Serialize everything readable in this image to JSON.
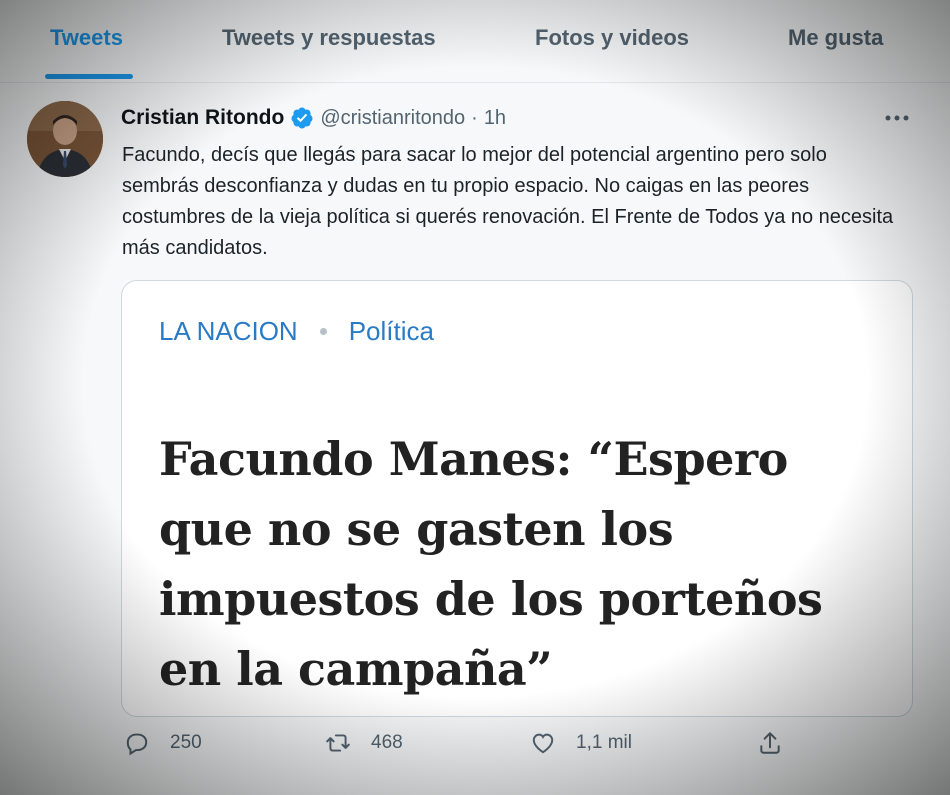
{
  "tabs": [
    {
      "label": "Tweets",
      "active": true
    },
    {
      "label": "Tweets y respuestas",
      "active": false
    },
    {
      "label": "Fotos y videos",
      "active": false
    },
    {
      "label": "Me gusta",
      "active": false
    }
  ],
  "tweet": {
    "author_name": "Cristian Ritondo",
    "verified": true,
    "handle": "@cristianritondo",
    "separator": "·",
    "time": "1h",
    "more_icon": "more-horizontal-icon",
    "text": "Facundo, decís que llegás para sacar lo mejor del potencial argentino pero solo sembrás desconfianza y dudas en tu propio espacio. No caigas en las peores costumbres de la vieja política si querés renovación. El Frente de Todos ya no necesita más candidatos.",
    "card": {
      "source": "LA NACION",
      "section": "Política",
      "headline": "Facundo Manes: “Espero que no se gasten los impuestos de los porteños en la campaña”"
    },
    "actions": {
      "replies": "250",
      "retweets": "468",
      "likes": "1,1 mil"
    }
  },
  "colors": {
    "accent": "#1d9bf0",
    "link": "#2a7bc5",
    "muted": "#536471"
  }
}
